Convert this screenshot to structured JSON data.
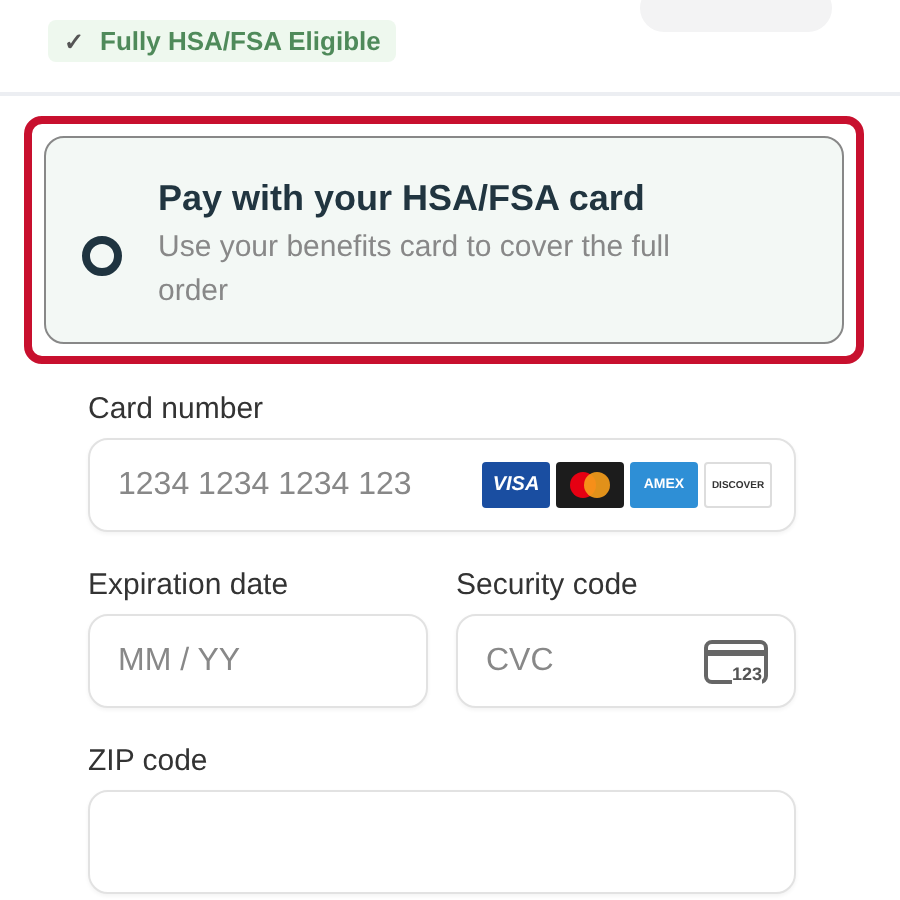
{
  "eligibility_badge": {
    "icon": "✓",
    "label": "Fully HSA/FSA Eligible"
  },
  "payment_option": {
    "title": "Pay with your HSA/FSA card",
    "description": "Use your benefits card to cover the full order",
    "selected": true,
    "highlighted": true
  },
  "card_number": {
    "label": "Card number",
    "placeholder": "1234 1234 1234 123",
    "brands": [
      {
        "kind": "visa",
        "label": "VISA"
      },
      {
        "kind": "mastercard"
      },
      {
        "kind": "amex",
        "label": "AMEX"
      },
      {
        "kind": "discover",
        "label": "DISCOVER"
      }
    ]
  },
  "expiration": {
    "label": "Expiration date",
    "placeholder": "MM / YY"
  },
  "security_code": {
    "label": "Security code",
    "placeholder": "CVC",
    "icon_text": "123"
  },
  "zip": {
    "label": "ZIP code"
  }
}
